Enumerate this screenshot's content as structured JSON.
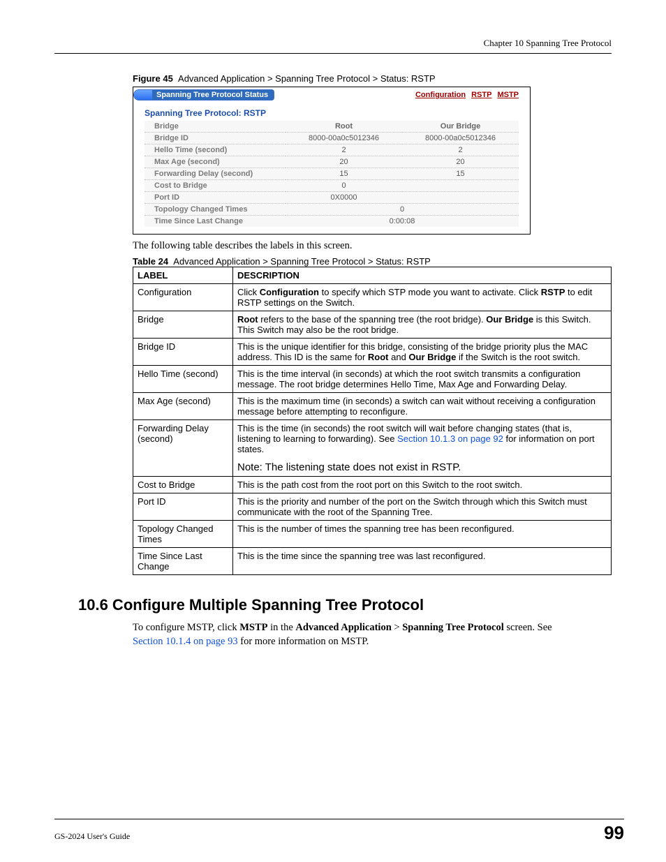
{
  "header": {
    "chapter": "Chapter 10 Spanning Tree Protocol"
  },
  "figure": {
    "label": "Figure 45",
    "caption": "Advanced Application > Spanning Tree Protocol > Status: RSTP",
    "titlebar": "Spanning Tree Protocol Status",
    "nav": {
      "config": "Configuration",
      "rstp": "RSTP",
      "mstp": "MSTP"
    },
    "subheading": "Spanning Tree Protocol: RSTP",
    "cols": {
      "root": "Root",
      "our": "Our Bridge"
    },
    "rows": {
      "bridge": {
        "label": "Bridge"
      },
      "bridge_id": {
        "label": "Bridge ID",
        "root": "8000-00a0c5012346",
        "our": "8000-00a0c5012346"
      },
      "hello": {
        "label": "Hello Time (second)",
        "root": "2",
        "our": "2"
      },
      "max_age": {
        "label": "Max Age (second)",
        "root": "20",
        "our": "20"
      },
      "fwd_delay": {
        "label": "Forwarding Delay (second)",
        "root": "15",
        "our": "15"
      },
      "cost": {
        "label": "Cost to Bridge",
        "root": "0",
        "our": ""
      },
      "port_id": {
        "label": "Port ID",
        "root": "0X0000",
        "our": ""
      },
      "topo": {
        "label": "Topology Changed Times",
        "center": "0"
      },
      "since": {
        "label": "Time Since Last Change",
        "center": "0:00:08"
      }
    }
  },
  "lead_para": "The following table describes the labels in this screen.",
  "table": {
    "label": "Table 24",
    "caption": "Advanced Application > Spanning Tree Protocol > Status: RSTP",
    "head": {
      "label": "LABEL",
      "desc": "DESCRIPTION"
    },
    "rows": [
      {
        "label": "Configuration",
        "desc_pre": "Click ",
        "b1": "Configuration",
        "desc_mid": " to specify which STP mode you want to activate. Click ",
        "b2": "RSTP",
        "desc_post": " to edit RSTP settings on the Switch."
      },
      {
        "label": "Bridge",
        "b1": "Root",
        "desc_mid": " refers to the base of the spanning tree (the root bridge). ",
        "b2": "Our Bridge",
        "desc_post": " is this Switch. This Switch may also be the root bridge."
      },
      {
        "label": "Bridge ID",
        "desc_pre": "This is the unique identifier for this bridge, consisting of the bridge priority plus the MAC address. This ID is the same for ",
        "b1": "Root",
        "desc_mid": " and ",
        "b2": "Our Bridge",
        "desc_post": " if the Switch is the root switch."
      },
      {
        "label": "Hello Time (second)",
        "desc_plain": "This is the time interval (in seconds) at which the root switch transmits a configuration message. The root bridge determines Hello Time, Max Age and Forwarding Delay."
      },
      {
        "label": "Max Age (second)",
        "desc_plain": "This is the maximum time (in seconds) a switch can wait without receiving a configuration message before attempting to reconfigure."
      },
      {
        "label": "Forwarding Delay (second)",
        "desc_pre": "This is the time (in seconds) the root switch will wait before changing states (that is, listening to learning to forwarding). See ",
        "link": "Section 10.1.3 on page 92",
        "desc_post": " for information on port states.",
        "note": "Note: The listening state does not exist in RSTP."
      },
      {
        "label": "Cost to Bridge",
        "desc_plain": "This is the path cost from the root port on this Switch to the root switch."
      },
      {
        "label": "Port ID",
        "desc_plain": "This is the priority and number of the port on the Switch through which this Switch must communicate with the root of the Spanning Tree."
      },
      {
        "label": "Topology Changed Times",
        "desc_plain": "This is the number of times the spanning tree has been reconfigured."
      },
      {
        "label": "Time Since Last Change",
        "desc_plain": "This is the time since the spanning tree was last reconfigured."
      }
    ]
  },
  "section": {
    "heading": "10.6  Configure Multiple Spanning Tree Protocol",
    "para_pre": "To configure MSTP, click ",
    "b1": "MSTP",
    "mid1": " in the ",
    "b2": "Advanced Application",
    "mid2": " > ",
    "b3": "Spanning Tree Protocol",
    "mid3": " screen. See ",
    "link": "Section 10.1.4 on page 93",
    "post": " for more information on MSTP."
  },
  "footer": {
    "guide": "GS-2024 User's Guide",
    "page": "99"
  }
}
